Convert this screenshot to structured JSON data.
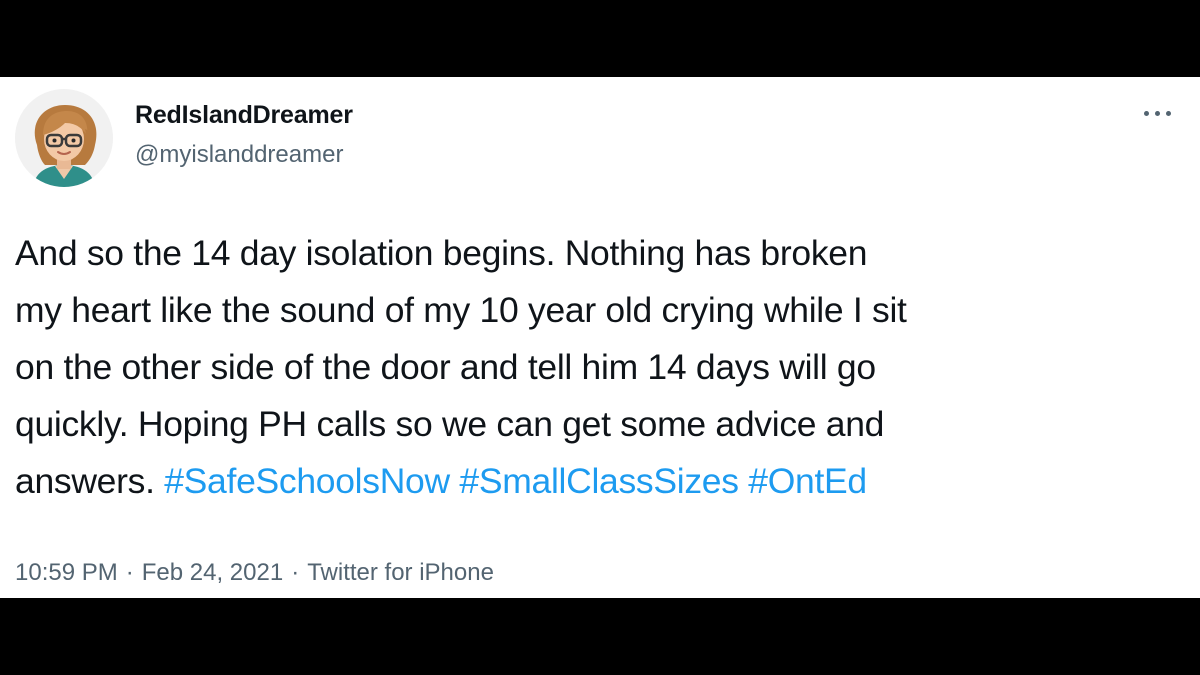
{
  "tweet": {
    "author": {
      "display_name": "RedIslandDreamer",
      "handle": "@myislanddreamer",
      "avatar": "cartoon-avatar-woman-with-glasses"
    },
    "more_icon": "ellipsis-icon",
    "text_lines": [
      "And so the 14 day isolation begins. Nothing has broken",
      "my heart like the sound of my 10 year old crying while I sit",
      "on the other side of the door and tell him 14 days will go",
      "quickly. Hoping PH calls so we can get some advice and",
      "answers."
    ],
    "hashtags": [
      "#SafeSchoolsNow",
      "#SmallClassSizes",
      "#OntEd"
    ],
    "time": "10:59 PM",
    "date": "Feb 24, 2021",
    "separator": "·",
    "source": "Twitter for iPhone"
  },
  "colors": {
    "text": "#0f1419",
    "secondary": "#536471",
    "link": "#1d9bf0",
    "background": "#ffffff",
    "letterbox": "#000000"
  }
}
